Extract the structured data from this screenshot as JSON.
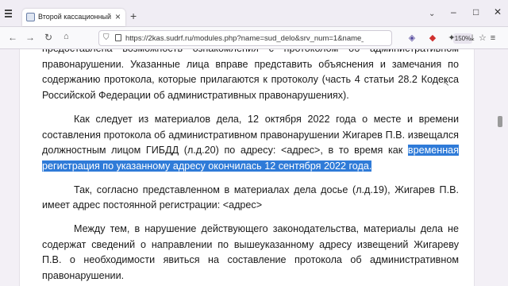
{
  "browser": {
    "tab_title": "Второй кассационный суд об",
    "tab_close": "×",
    "new_tab": "+",
    "tabs_menu": "⌄",
    "window_controls": {
      "minimize": "–",
      "maximize": "□",
      "close": "✕"
    },
    "nav": {
      "back": "←",
      "forward": "→",
      "reload": "↻"
    },
    "url": "https://2kas.sudrf.ru/modules.php?name=sud_delo&srv_num=1&name_op",
    "zoom": "150%",
    "accent_color": "#2f7bd8"
  },
  "document": {
    "paragraphs": [
      {
        "segments": [
          {
            "text": "предоставлена возможность ознакомления с протоколом об административном правонарушении. Указанные лица вправе представить объяснения и замечания по содержанию протокола, которые прилагаются к протоколу (часть 4 статьи 28.2 Кодекса Российской Федерации об административных правонарушениях).",
            "highlight": false
          }
        ]
      },
      {
        "segments": [
          {
            "text": "Как следует из материалов дела, 12 октября 2022 года о месте и времени составления протокола об административном правонарушении Жигарев П.В. извещался должностным лицом ГИБДД (л.д.20) по адресу: <адрес>, в то время как ",
            "highlight": false
          },
          {
            "text": "временная регистрация по указанному адресу окончилась 12 сентября 2022 года.",
            "highlight": true
          }
        ]
      },
      {
        "segments": [
          {
            "text": "Так, согласно представленном в материалах дела досье (л.д.19), Жигарев П.В. имеет адрес постоянной регистрации: <адрес>",
            "highlight": false
          }
        ]
      },
      {
        "segments": [
          {
            "text": "Между тем, в нарушение действующего законодательства, материалы дела не содержат сведений о направлении по вышеуказанному адресу извещений Жигареву П.В. о необходимости явиться на составление протокола об административном правонарушении.",
            "highlight": false
          }
        ]
      }
    ]
  }
}
